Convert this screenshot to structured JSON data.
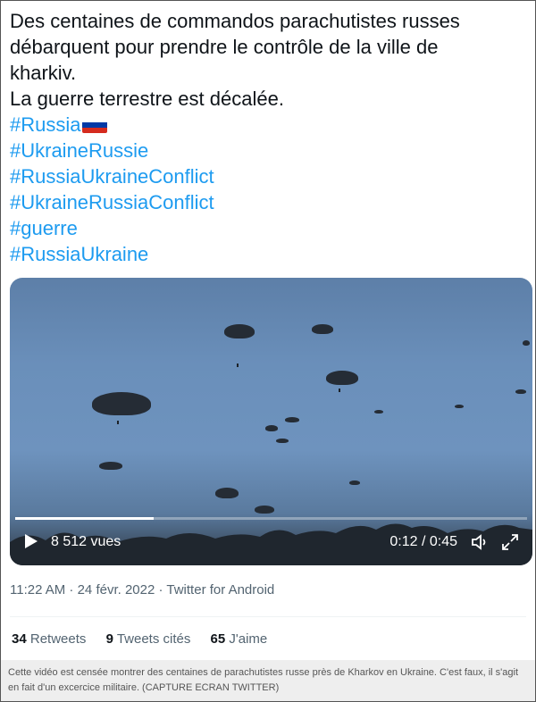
{
  "tweet": {
    "text_lines": [
      "Des centaines de commandos parachutistes russes",
      "débarquent pour prendre le contrôle de la ville de",
      "kharkiv.",
      "La guerre terrestre est décalée."
    ],
    "hashtags": [
      "#Russia",
      "#UkraineRussie",
      "#RussiaUkraineConflict",
      "#UkraineRussiaConflict",
      "#guerre",
      "#RussiaUkraine"
    ],
    "flag_icon": "russian-flag"
  },
  "video": {
    "views": "8 512 vues",
    "time": "0:12 / 0:45",
    "progress_fraction": 0.27,
    "play_icon": "play-icon",
    "volume_icon": "volume-icon",
    "fullscreen_icon": "fullscreen-icon"
  },
  "meta": {
    "timestamp": "11:22 AM · 24 févr. 2022 · Twitter for Android"
  },
  "stats": {
    "retweets_count": "34",
    "retweets_label": "Retweets",
    "quotes_count": "9",
    "quotes_label": "Tweets cités",
    "likes_count": "65",
    "likes_label": "J'aime"
  },
  "caption": "Cette vidéo est censée montrer des centaines de parachutistes russe près de Kharkov en Ukraine. C'est faux, il s'agit en fait d'un excercice militaire. (CAPTURE ECRAN TWITTER)",
  "colors": {
    "hashtag": "#1d9bf0",
    "text": "#0f1419",
    "muted": "#536471",
    "caption_bg": "#eeeeee"
  }
}
